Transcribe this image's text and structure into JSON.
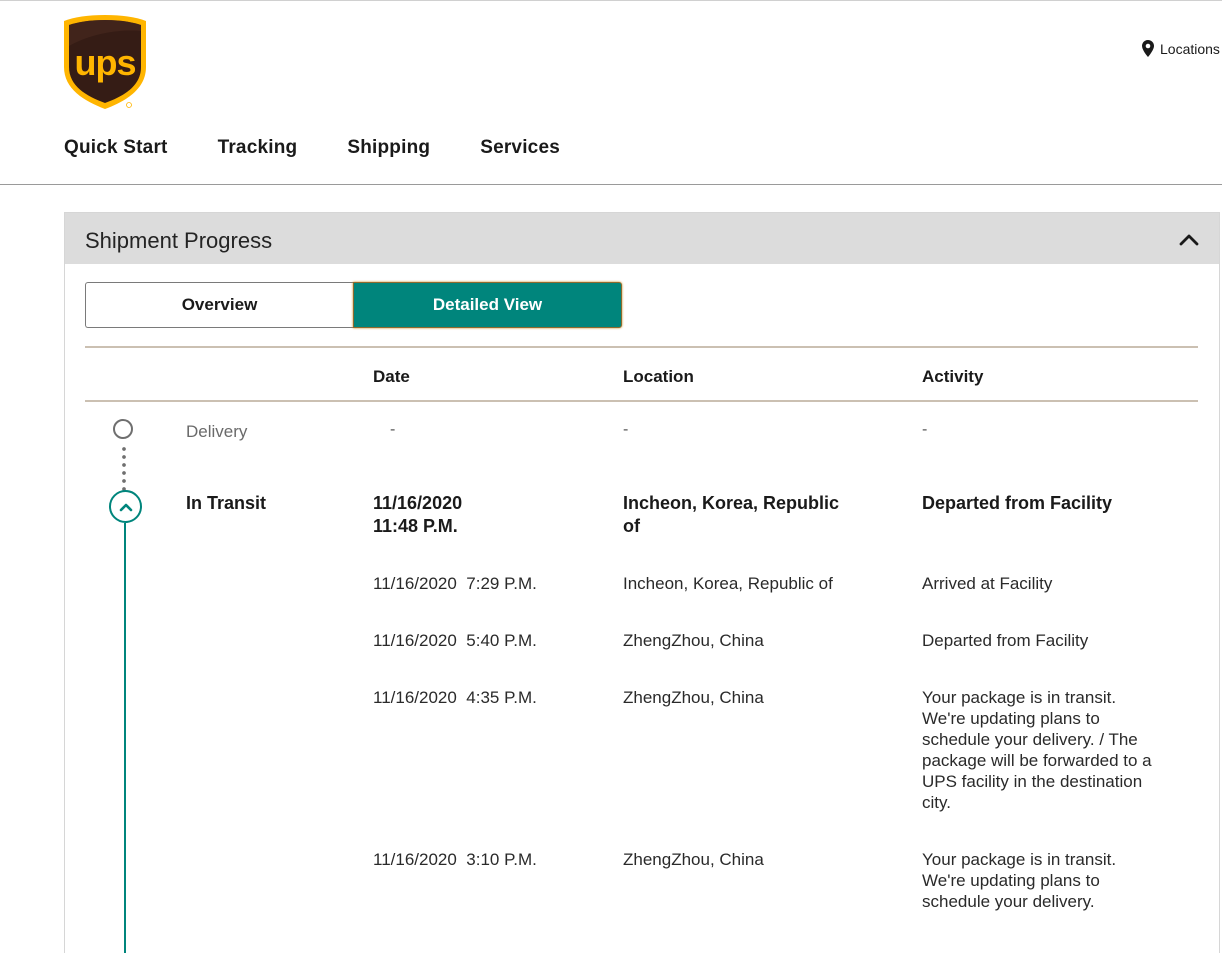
{
  "header": {
    "logo_text": "ups",
    "locations_label": "Locations",
    "nav": [
      "Quick Start",
      "Tracking",
      "Shipping",
      "Services"
    ]
  },
  "panel": {
    "title": "Shipment Progress",
    "toggle": {
      "overview": "Overview",
      "detailed": "Detailed View",
      "active": "detailed"
    },
    "columns": {
      "date": "Date",
      "location": "Location",
      "activity": "Activity"
    },
    "stages": [
      {
        "label": "Delivery",
        "date": "-",
        "location": "-",
        "activity": "-"
      },
      {
        "label": "In Transit",
        "date_line1": "11/16/2020",
        "date_line2": "11:48 P.M.",
        "location_line1": "Incheon, Korea, Republic",
        "location_line2": "of",
        "activity": "Departed from Facility"
      }
    ],
    "events": [
      {
        "date": "11/16/2020  7:29 P.M.",
        "location": "Incheon, Korea, Republic of",
        "activity_lines": [
          "Arrived at Facility"
        ]
      },
      {
        "date": "11/16/2020  5:40 P.M.",
        "location": "ZhengZhou, China",
        "activity_lines": [
          "Departed from Facility"
        ]
      },
      {
        "date": "11/16/2020  4:35 P.M.",
        "location": "ZhengZhou, China",
        "activity_lines": [
          "Your package is in transit.",
          "We're updating plans to",
          "schedule your delivery. / The",
          "package will be forwarded to a",
          "UPS facility in the destination",
          "city."
        ]
      },
      {
        "date": "11/16/2020  3:10 P.M.",
        "location": "ZhengZhou, China",
        "activity_lines": [
          "Your package is in transit.",
          "We're updating plans to",
          "schedule your delivery."
        ]
      }
    ]
  },
  "colors": {
    "accent": "#00857c",
    "brand_brown": "#351c15",
    "brand_gold": "#ffb500"
  }
}
